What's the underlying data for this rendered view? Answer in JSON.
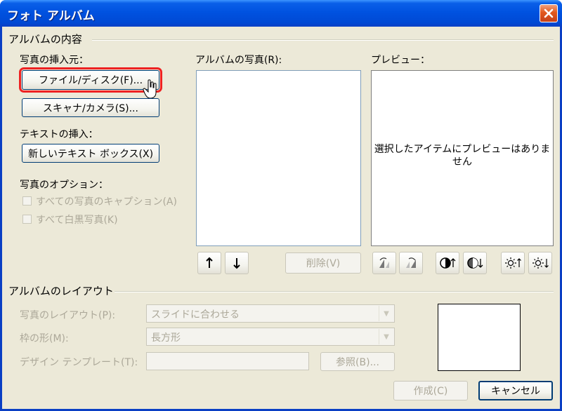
{
  "window": {
    "title": "フォト アルバム"
  },
  "content_group": {
    "title": "アルバムの内容",
    "insert_from_label": "写真の挿入元：",
    "file_disk_button": "ファイル/ディスク(F)...",
    "scanner_camera_button": "スキャナ/カメラ(S)...",
    "insert_text_label": "テキストの挿入：",
    "new_textbox_button": "新しいテキスト ボックス(X)",
    "photo_options_label": "写真のオプション：",
    "caption_checkbox": "すべての写真のキャプション(A)",
    "bw_checkbox": "すべて白黒写真(K)"
  },
  "album_photos": {
    "label": "アルバムの写真(R):",
    "delete_button": "削除(V)"
  },
  "preview": {
    "label": "プレビュー：",
    "message": "選択したアイテムにプレビューはありません"
  },
  "layout_group": {
    "title": "アルバムのレイアウト",
    "picture_layout_label": "写真のレイアウト(P):",
    "picture_layout_value": "スライドに合わせる",
    "frame_shape_label": "枠の形(M):",
    "frame_shape_value": "長方形",
    "design_template_label": "デザイン テンプレート(T):",
    "browse_button": "参照(B)..."
  },
  "footer": {
    "create_button": "作成(C)",
    "cancel_button": "キャンセル"
  },
  "colors": {
    "title_bar": "#0052e0",
    "dialog_bg": "#ece9d8",
    "highlight": "#ee2222"
  }
}
